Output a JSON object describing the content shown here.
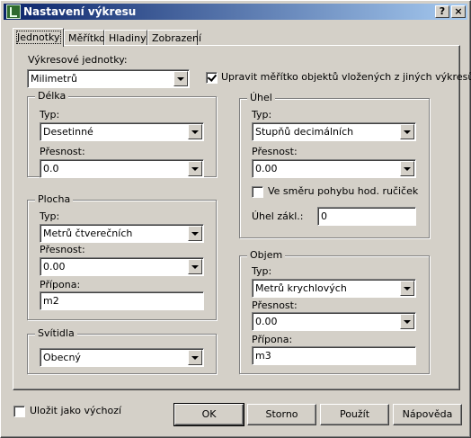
{
  "window": {
    "title": "Nastavení výkresu",
    "help_button": "?",
    "close_button": "×"
  },
  "tabs": [
    {
      "label": "Jednotky",
      "active": true
    },
    {
      "label": "Měřítko",
      "active": false
    },
    {
      "label": "Hladiny",
      "active": false
    },
    {
      "label": "Zobrazení",
      "active": false
    }
  ],
  "units": {
    "drawing_units_label": "Výkresové jednotky:",
    "drawing_units_value": "Milimetrů",
    "scale_checkbox_label": "Upravit měřítko objektů vložených z jiných výkresů",
    "scale_checkbox_checked": true
  },
  "length": {
    "title": "Délka",
    "type_label": "Typ:",
    "type_value": "Desetinné",
    "precision_label": "Přesnost:",
    "precision_value": "0.0"
  },
  "area": {
    "title": "Plocha",
    "type_label": "Typ:",
    "type_value": "Metrů čtverečních",
    "precision_label": "Přesnost:",
    "precision_value": "0.00",
    "suffix_label": "Přípona:",
    "suffix_value": "m2"
  },
  "luminaires": {
    "title": "Svítidla",
    "value": "Obecný"
  },
  "angle": {
    "title": "Úhel",
    "type_label": "Typ:",
    "type_value": "Stupňů decimálních",
    "precision_label": "Přesnost:",
    "precision_value": "0.00",
    "clockwise_label": "Ve směru pohybu hod. ručiček",
    "clockwise_checked": false,
    "base_label": "Úhel zákl.:",
    "base_value": "0"
  },
  "volume": {
    "title": "Objem",
    "type_label": "Typ:",
    "type_value": "Metrů krychlových",
    "precision_label": "Přesnost:",
    "precision_value": "0.00",
    "suffix_label": "Přípona:",
    "suffix_value": "m3"
  },
  "footer": {
    "save_default_label": "Uložit jako výchozí",
    "save_default_checked": false,
    "ok": "OK",
    "cancel": "Storno",
    "apply": "Použít",
    "help": "Nápověda"
  }
}
